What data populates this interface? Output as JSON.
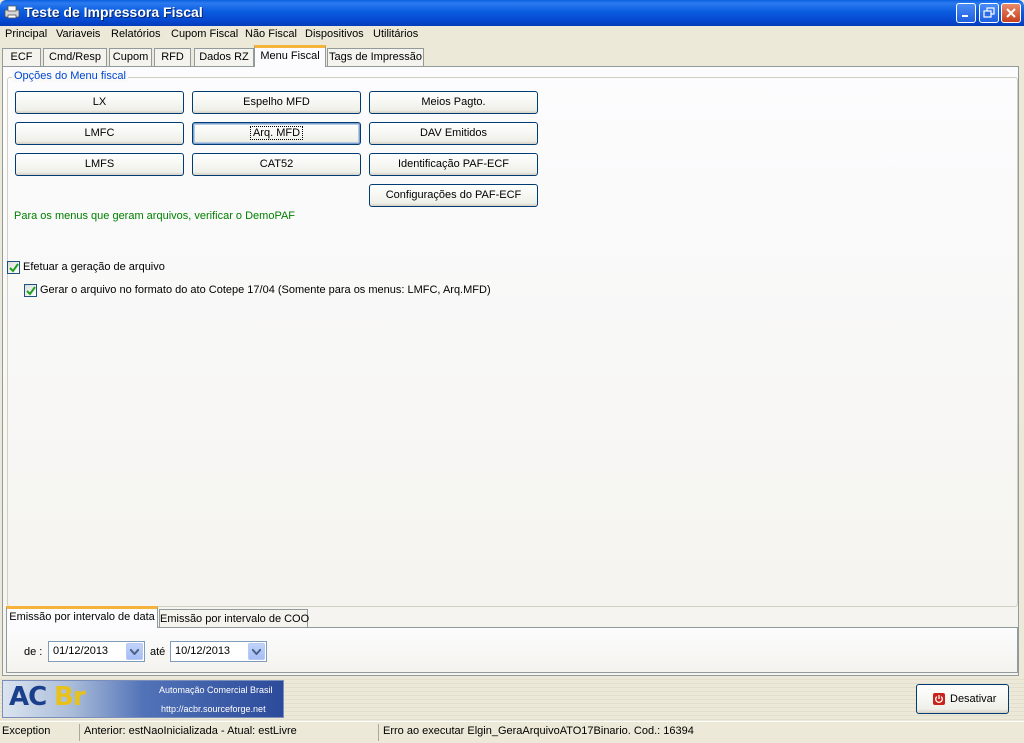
{
  "window": {
    "title": "Teste de Impressora Fiscal"
  },
  "menu": [
    "Principal",
    "Variaveis",
    "Relatórios",
    "Cupom Fiscal",
    "Não Fiscal",
    "Dispositivos",
    "Utilitários"
  ],
  "tabs": [
    "ECF",
    "Cmd/Resp",
    "Cupom",
    "RFD",
    "Dados RZ",
    "Menu Fiscal",
    "Tags de Impressão"
  ],
  "active_tab": "Menu Fiscal",
  "group": {
    "title": "Opções do Menu fiscal"
  },
  "buttons": {
    "lx": "LX",
    "espelho_mfd": "Espelho MFD",
    "meios_pagto": "Meios Pagto.",
    "lmfc": "LMFC",
    "arq_mfd": "Arq. MFD",
    "dav_emitidos": "DAV Emitidos",
    "lmfs": "LMFS",
    "cat52": "CAT52",
    "identificacao_paf": "Identificação PAF-ECF",
    "configuracoes_paf": "Configurações do PAF-ECF"
  },
  "note": "Para os menus que geram arquivos, verificar o DemoPAF",
  "checkboxes": {
    "gerar_arquivo": {
      "label": "Efetuar a geração de arquivo",
      "checked": true
    },
    "formato_cotepe": {
      "label": "Gerar o arquivo no formato do ato Cotepe 17/04 (Somente para os menus: LMFC, Arq.MFD)",
      "checked": true
    }
  },
  "period_tabs": [
    "Emissão por intervalo de data",
    "Emissão por intervalo de COO"
  ],
  "period": {
    "from_label": "de :",
    "from_value": "01/12/2013",
    "to_label": "até",
    "to_value": "10/12/2013"
  },
  "banner": {
    "logo_ac": "AC",
    "logo_br": "Br",
    "title": "Automação Comercial Brasil",
    "url": "http://acbr.sourceforge.net"
  },
  "desativar_label": "Desativar",
  "status": {
    "panel1": "Exception",
    "panel2": "Anterior: estNaoInicializada - Atual: estLivre",
    "panel3": "Erro ao executar Elgin_GeraArquivoATO17Binario.  Cod.: 16394"
  },
  "colors": {
    "title_bar": "#0a5ce0",
    "note_text": "#008000",
    "active_tab_accent": "#f5b33b",
    "group_title": "#0046d5"
  }
}
